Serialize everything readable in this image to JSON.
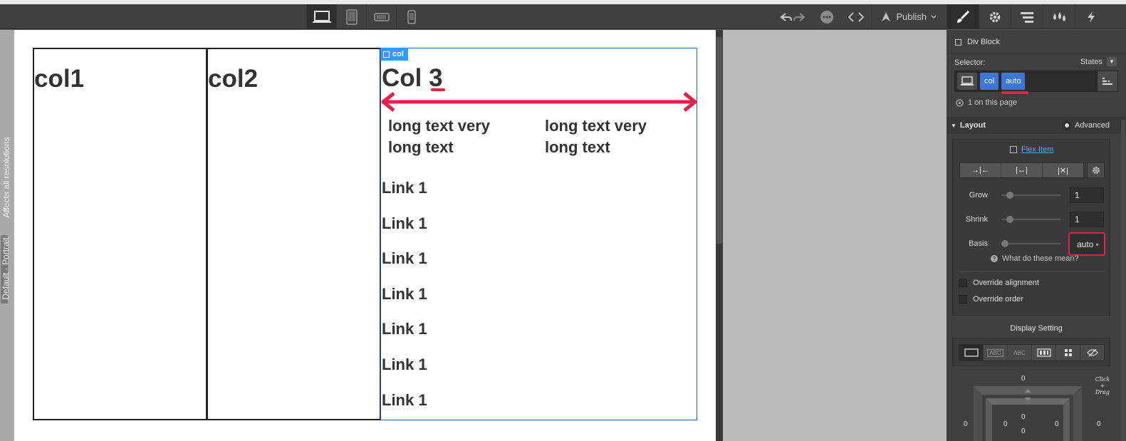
{
  "toolbar": {
    "devices": [
      "desktop-icon",
      "tablet-icon",
      "mobile-landscape-icon",
      "mobile-portrait-icon"
    ],
    "publish_label": "Publish"
  },
  "panel_tabs": [
    "brush-icon",
    "gear-icon",
    "navigator-icon",
    "drops-icon",
    "lightning-icon"
  ],
  "left_strip": {
    "affects": "Affects all resolutions",
    "badge": "Default · Portrait"
  },
  "canvas": {
    "columns": [
      {
        "title": "col1"
      },
      {
        "title": "col2"
      },
      {
        "title": "Col 3",
        "tag": "col"
      }
    ],
    "long_texts": [
      "long text very long text",
      "long text very long text"
    ],
    "links": [
      "Link 1",
      "Link 1",
      "Link 1",
      "Link 1",
      "Link 1",
      "Link 1",
      "Link 1"
    ]
  },
  "panel": {
    "element_name": "Div Block",
    "selector_label": "Selector:",
    "states_label": "States",
    "chips": [
      "col",
      "auto"
    ],
    "on_page": "1 on this page",
    "layout": {
      "title": "Layout",
      "advanced": "Advanced",
      "flex_item": "Flex Item",
      "grow_label": "Grow",
      "grow_value": "1",
      "shrink_label": "Shrink",
      "shrink_value": "1",
      "basis_label": "Basis",
      "basis_value": "auto",
      "help": "What do these mean?",
      "override_alignment": "Override alignment",
      "override_order": "Override order"
    },
    "display": {
      "title": "Display Setting",
      "options": [
        "block",
        "ABC",
        "ABC",
        "flex",
        "grid",
        "none"
      ]
    },
    "spacing": {
      "margin_top": "0",
      "margin_left": "0",
      "margin_right": "0",
      "padding_top": "0",
      "padding_left": "0",
      "padding_right": "0",
      "padding_bottom": "0",
      "click_drag": "Click + Drag"
    }
  },
  "colors": {
    "accent": "#3d78d6",
    "annotation": "#e0224e",
    "selection": "#3498ff"
  }
}
